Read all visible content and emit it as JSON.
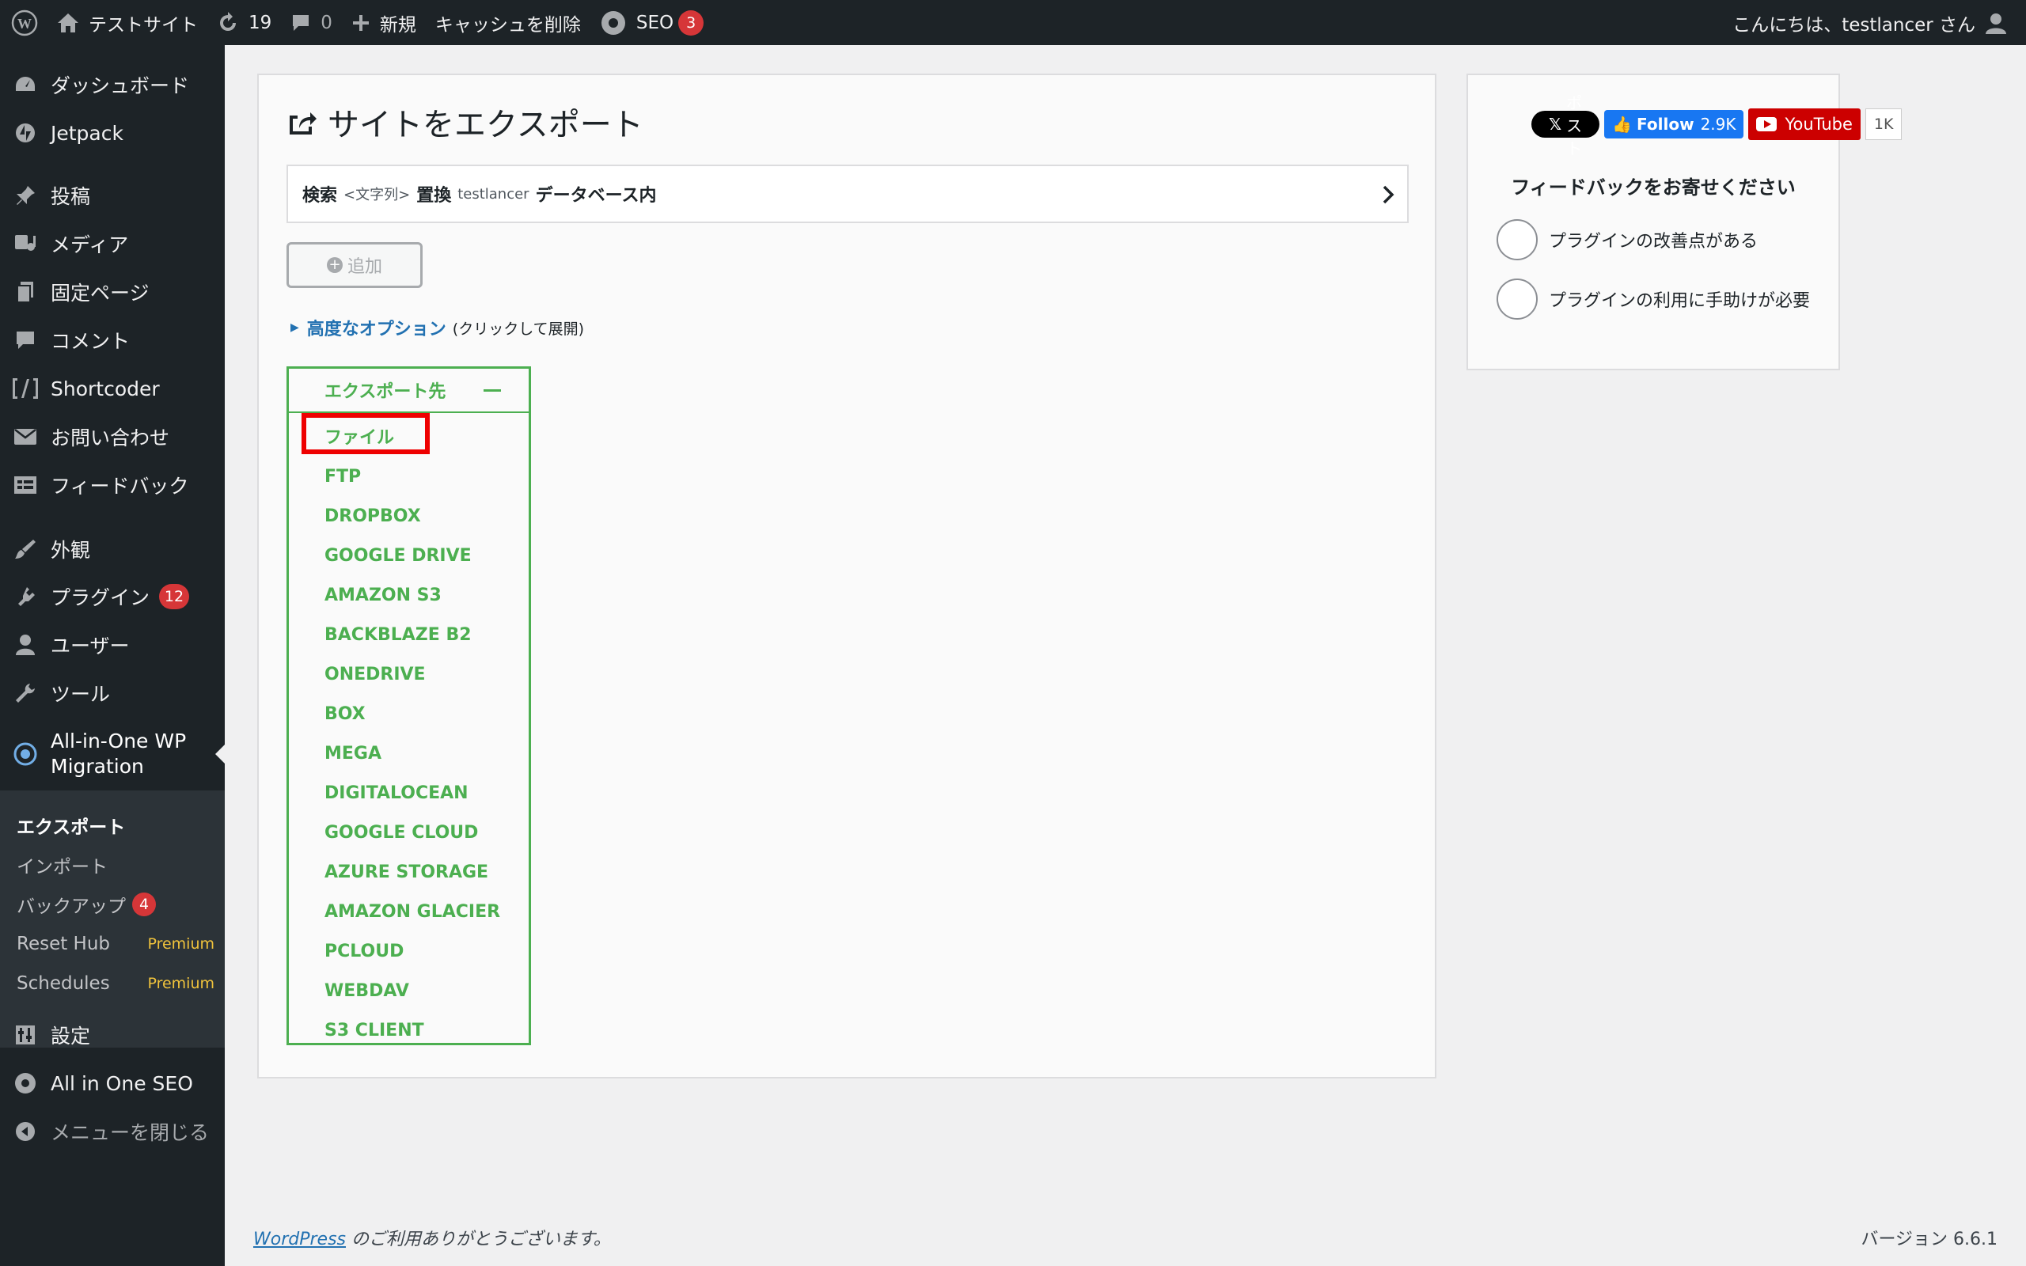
{
  "admin_bar": {
    "site_name": "テストサイト",
    "updates_count": "19",
    "comments_count": "0",
    "new_label": "新規",
    "cache_label": "キャッシュを削除",
    "seo_label": "SEO",
    "seo_badge": "3",
    "greeting": "こんにちは、testlancer さん"
  },
  "sidebar": {
    "items": [
      {
        "label": "ダッシュボード",
        "icon": "dashboard-icon"
      },
      {
        "label": "Jetpack",
        "icon": "jetpack-icon"
      },
      {
        "label": "投稿",
        "icon": "pin-icon"
      },
      {
        "label": "メディア",
        "icon": "media-icon"
      },
      {
        "label": "固定ページ",
        "icon": "pages-icon"
      },
      {
        "label": "コメント",
        "icon": "comment-icon"
      },
      {
        "label": "Shortcoder",
        "icon": "shortcode-icon"
      },
      {
        "label": "お問い合わせ",
        "icon": "mail-icon"
      },
      {
        "label": "フィードバック",
        "icon": "feedback-icon"
      },
      {
        "label": "外観",
        "icon": "brush-icon"
      },
      {
        "label": "プラグイン",
        "icon": "plugin-icon",
        "badge": "12"
      },
      {
        "label": "ユーザー",
        "icon": "user-icon"
      },
      {
        "label": "ツール",
        "icon": "wrench-icon"
      }
    ],
    "active_item": {
      "label_line1": "All-in-One WP",
      "label_line2": "Migration"
    },
    "submenu": [
      {
        "label": "エクスポート"
      },
      {
        "label": "インポート"
      },
      {
        "label": "バックアップ",
        "badge": "4"
      },
      {
        "label": "Reset Hub",
        "tag": "Premium"
      },
      {
        "label": "Schedules",
        "tag": "Premium"
      }
    ],
    "after_items": [
      {
        "label": "設定",
        "icon": "settings-icon"
      },
      {
        "label": "All in One SEO",
        "icon": "seo-icon"
      },
      {
        "label": "メニューを閉じる",
        "icon": "collapse-icon"
      }
    ]
  },
  "export": {
    "title": "サイトをエクスポート",
    "find_replace": {
      "search": "検索",
      "text_placeholder": "<文字列>",
      "replace": "置換",
      "value": "testlancer",
      "scope": "データベース内"
    },
    "add_button": "追加",
    "advanced_options": "高度なオプション",
    "advanced_hint": "(クリックして展開)",
    "export_to_label": "エクスポート先",
    "destinations": [
      "ファイル",
      "FTP",
      "DROPBOX",
      "GOOGLE DRIVE",
      "AMAZON S3",
      "BACKBLAZE B2",
      "ONEDRIVE",
      "BOX",
      "MEGA",
      "DIGITALOCEAN",
      "GOOGLE CLOUD",
      "AZURE STORAGE",
      "AMAZON GLACIER",
      "PCLOUD",
      "WEBDAV",
      "S3 CLIENT"
    ]
  },
  "feedback": {
    "x_label": "ポスト",
    "fb_label": "Follow",
    "fb_count": "2.9K",
    "yt_label": "YouTube",
    "yt_count": "1K",
    "title": "フィードバックをお寄せください",
    "options": [
      "プラグインの改善点がある",
      "プラグインの利用に手助けが必要"
    ]
  },
  "footer": {
    "wp_link": "WordPress",
    "thanks": " のご利用ありがとうございます。",
    "version": "バージョン 6.6.1"
  },
  "colors": {
    "admin_bg": "#1d2327",
    "accent_green": "#4caf50",
    "badge_red": "#d63638",
    "link_blue": "#2271b1",
    "highlight_red": "#ee0000"
  }
}
